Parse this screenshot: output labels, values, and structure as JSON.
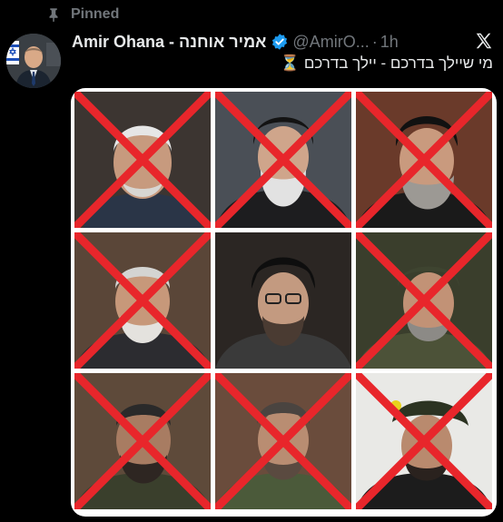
{
  "pinned": {
    "label": "Pinned",
    "icon": "pin-icon"
  },
  "author": {
    "display_name": "Amir Ohana - אמיר אוחנה",
    "handle": "@AmirO...",
    "separator": "·",
    "time": "1h",
    "verified_icon": "verified-badge-icon"
  },
  "tweet": {
    "text": "מי שיילך בדרכם - יילך בדרכם",
    "emoji": "⏳"
  },
  "media": {
    "cross_color": "#e8262b",
    "tiles": [
      {
        "index": 1,
        "crossed": true
      },
      {
        "index": 2,
        "crossed": true
      },
      {
        "index": 3,
        "crossed": true
      },
      {
        "index": 4,
        "crossed": true
      },
      {
        "index": 5,
        "crossed": false
      },
      {
        "index": 6,
        "crossed": true
      },
      {
        "index": 7,
        "crossed": true
      },
      {
        "index": 8,
        "crossed": true
      },
      {
        "index": 9,
        "crossed": true
      }
    ]
  },
  "colors": {
    "background": "#000000",
    "text_primary": "#e7e9ea",
    "text_secondary": "#71767b",
    "verified_blue": "#1d9bf0"
  }
}
